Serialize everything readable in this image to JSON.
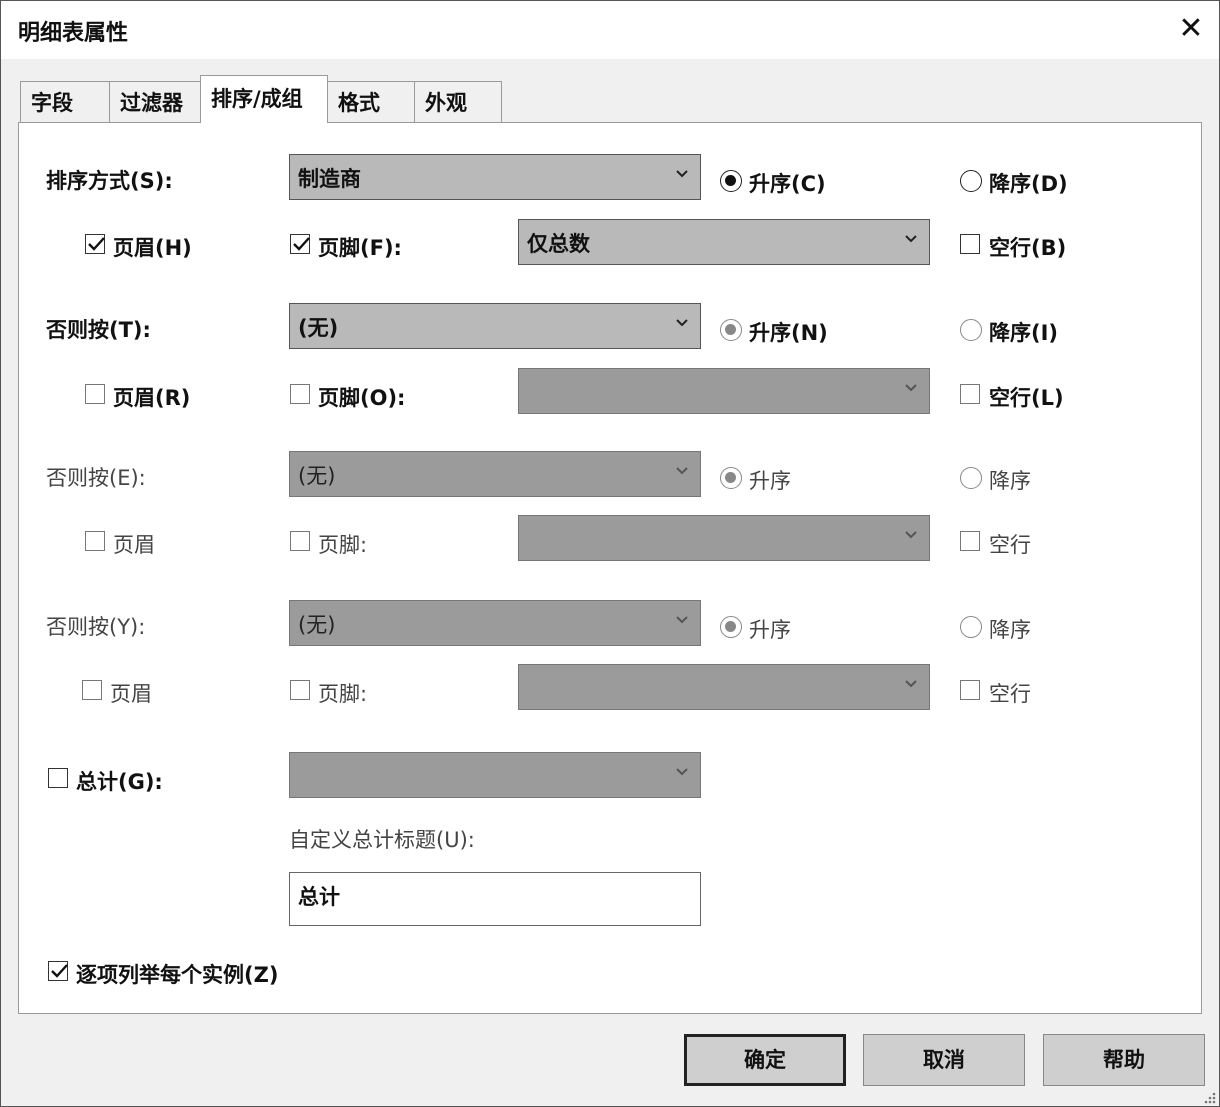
{
  "window": {
    "title": "明细表属性",
    "close_glyph": "✕"
  },
  "tabs": [
    {
      "label": "字段"
    },
    {
      "label": "过滤器"
    },
    {
      "label": "排序/成组",
      "active": true
    },
    {
      "label": "格式"
    },
    {
      "label": "外观"
    }
  ],
  "sort_groups": [
    {
      "label": "排序方式(S):",
      "combo_value": "制造商",
      "asc_label": "升序(C)",
      "desc_label": "降序(D)",
      "order": "ascending",
      "header_label": "页眉(H)",
      "header_checked": true,
      "footer_label": "页脚(F):",
      "footer_checked": true,
      "footer_combo_value": "仅总数",
      "blank_label": "空行(B)",
      "blank_checked": false
    },
    {
      "label": "否则按(T):",
      "combo_value": "(无)",
      "asc_label": "升序(N)",
      "desc_label": "降序(I)",
      "order": "ascending",
      "header_label": "页眉(R)",
      "header_checked": false,
      "footer_label": "页脚(O):",
      "footer_checked": false,
      "footer_combo_value": "",
      "blank_label": "空行(L)",
      "blank_checked": false
    },
    {
      "label": "否则按(E):",
      "combo_value": "(无)",
      "asc_label": "升序",
      "desc_label": "降序",
      "order": "ascending",
      "header_label": "页眉",
      "header_checked": false,
      "footer_label": "页脚:",
      "footer_checked": false,
      "footer_combo_value": "",
      "blank_label": "空行",
      "blank_checked": false
    },
    {
      "label": "否则按(Y):",
      "combo_value": "(无)",
      "asc_label": "升序",
      "desc_label": "降序",
      "order": "ascending",
      "header_label": "页眉",
      "header_checked": false,
      "footer_label": "页脚:",
      "footer_checked": false,
      "footer_combo_value": "",
      "blank_label": "空行",
      "blank_checked": false
    }
  ],
  "grand_total": {
    "label": "总计(G):",
    "checked": false,
    "combo_value": ""
  },
  "custom_total_title": {
    "label": "自定义总计标题(U):",
    "value": "总计"
  },
  "itemize": {
    "label": "逐项列举每个实例(Z)",
    "checked": true
  },
  "buttons": {
    "ok": "确定",
    "cancel": "取消",
    "help": "帮助"
  }
}
